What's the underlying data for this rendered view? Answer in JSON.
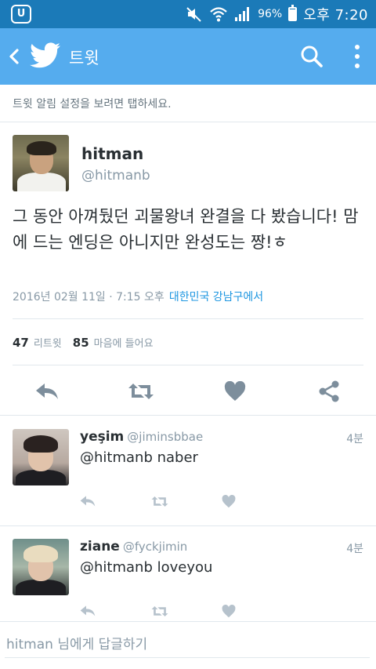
{
  "status_bar": {
    "app_badge": "U",
    "battery_percent": "96%",
    "battery_level": 0.96,
    "time": "오후 7:20"
  },
  "header": {
    "title": "트윗"
  },
  "notification_banner": "트윗 알림 설정을 보려면 탭하세요.",
  "tweet": {
    "name": "hitman",
    "handle": "@hitmanb",
    "text": "그 동안 아껴뒀던 괴물왕녀 완결을 다 봤습니다! 맘에 드는 엔딩은 아니지만 완성도는 짱!ㅎ",
    "timestamp": "2016년 02월 11일 · 7:15 오후",
    "location": "대한민국 강남구에서",
    "retweet_count": "47",
    "retweet_label": "리트윗",
    "like_count": "85",
    "like_label": "마음에 들어요"
  },
  "replies": [
    {
      "name": "yeşim",
      "handle": "@jiminsbbae",
      "time": "4분",
      "text": "@hitmanb naber"
    },
    {
      "name": "ziane",
      "handle": "@fyckjimin",
      "time": "4분",
      "text": "@hitmanb loveyou"
    }
  ],
  "composer": {
    "placeholder": "hitman 님에게 답글하기"
  },
  "colors": {
    "status_bar": "#1b7ab8",
    "app_bar": "#55acee",
    "action_icon": "#7d8e9c",
    "reply_action_icon": "#b6c2cc",
    "link": "#1b95e0"
  },
  "icons": [
    "mute-icon",
    "wifi-icon",
    "signal-icon",
    "battery-icon",
    "back-arrow-icon",
    "twitter-bird-icon",
    "search-icon",
    "more-vert-icon",
    "reply-icon",
    "retweet-icon",
    "heart-icon",
    "share-icon"
  ]
}
